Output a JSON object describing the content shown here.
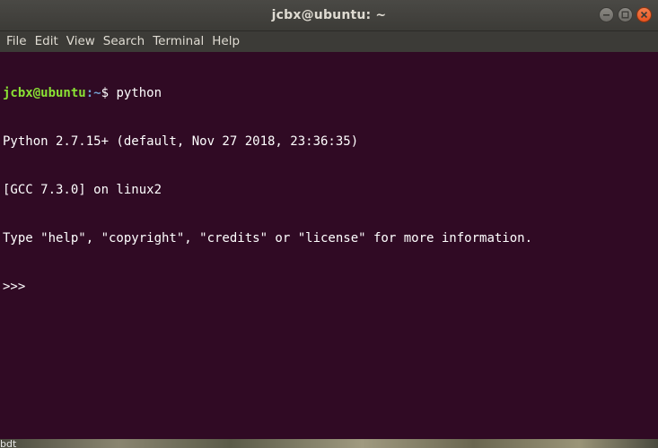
{
  "window": {
    "title": "jcbx@ubuntu: ~"
  },
  "menu": {
    "items": [
      "File",
      "Edit",
      "View",
      "Search",
      "Terminal",
      "Help"
    ]
  },
  "terminal": {
    "prompt_user_host": "jcbx@ubuntu",
    "prompt_path": ":~",
    "prompt_symbol": "$ ",
    "command": "python",
    "output": [
      "Python 2.7.15+ (default, Nov 27 2018, 23:36:35)",
      "[GCC 7.3.0] on linux2",
      "Type \"help\", \"copyright\", \"credits\" or \"license\" for more information."
    ],
    "repl_prompt": ">>> "
  },
  "desktop": {
    "fragment_text": "bdt"
  },
  "colors": {
    "terminal_bg": "#300a24",
    "titlebar_bg": "#3c3b37",
    "prompt_user": "#8ae234",
    "prompt_path": "#729fcf",
    "close_button": "#e9541f"
  }
}
